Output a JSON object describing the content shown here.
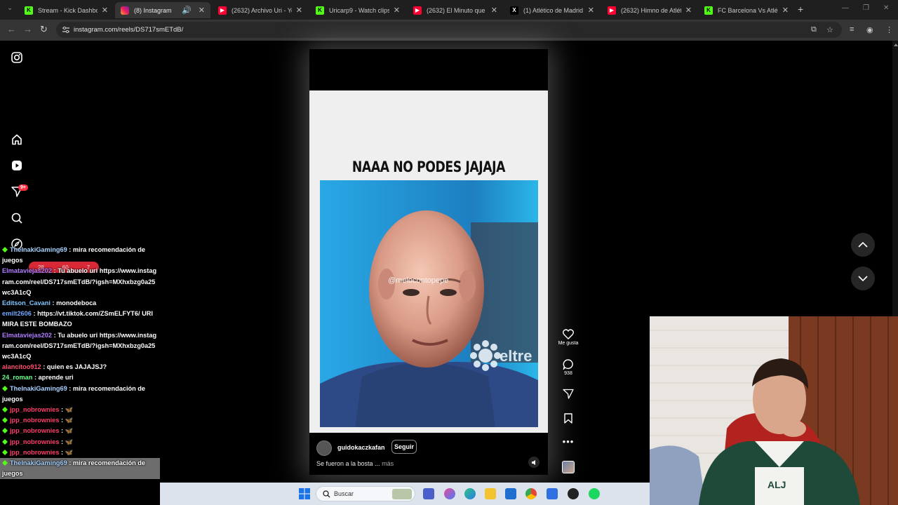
{
  "browser": {
    "tabs": [
      {
        "title": "Stream - Kick Dashboard",
        "favicon": "kick-icon",
        "active": false
      },
      {
        "title": "(8) Instagram",
        "favicon": "instagram-icon",
        "active": true
      },
      {
        "title": "(2632) Archivo Uri - YouTu",
        "favicon": "youtube-icon",
        "active": false
      },
      {
        "title": "Uricarp9 - Watch clips on",
        "favicon": "kick-icon",
        "active": false
      },
      {
        "title": "(2632) El Minuto que DES",
        "favicon": "youtube-icon",
        "active": false
      },
      {
        "title": "(1) Atlético de Madrid on",
        "favicon": "x-icon",
        "active": false
      },
      {
        "title": "(2632) Himno de Atlético",
        "favicon": "youtube-icon",
        "active": false
      },
      {
        "title": "FC Barcelona Vs Atlético",
        "favicon": "kick-icon",
        "active": false
      }
    ],
    "url": "instagram.com/reels/DS717smETdB/"
  },
  "instagram": {
    "nav_badge": "9+",
    "reel": {
      "overlay_text": "NAAA NO PODES JAJAJA",
      "watermark": "@melocontopepe",
      "channel_logo": "eltre",
      "username": "guidokaczkafan",
      "follow_label": "Seguir",
      "caption": "Se fueron a la bosta ...",
      "more_label": "más"
    },
    "actions": {
      "like_label": "Me gusta",
      "comment_count": "938"
    }
  },
  "chat": {
    "reactions": {
      "a": "28",
      "b": "60",
      "c": "7"
    },
    "messages": [
      {
        "user": "TheInakiGaming69",
        "color": "#a9d2ff",
        "text": ": mira recomendación de juegos",
        "badge": true
      },
      {
        "user": "Elmataviejas202",
        "color": "#b07cff",
        "text": ": Tu abuelo uri https://www.instagram.com/reel/DS717smETdB/?igsh=MXhxbzg0a25wc3A1cQ",
        "badge": false
      },
      {
        "user": "Editson_Cavani",
        "color": "#7cc8ff",
        "text": ": monodeboca",
        "badge": false
      },
      {
        "user": "emilt2606",
        "color": "#6fa8ff",
        "text": ": https://vt.tiktok.com/ZSmELFYT6/ URI MIRA ESTE BOMBAZO",
        "badge": false
      },
      {
        "user": "Elmataviejas202",
        "color": "#b07cff",
        "text": ": Tu abuelo uri https://www.instagram.com/reel/DS717smETdB/?igsh=MXhxbzg0a25wc3A1cQ",
        "badge": false
      },
      {
        "user": "alancitoo912",
        "color": "#ff4d6d",
        "text": ": quien es JAJAJSJ?",
        "badge": false
      },
      {
        "user": "24_roman",
        "color": "#6aff8a",
        "text": ": aprende uri",
        "badge": false
      },
      {
        "user": "TheInakiGaming69",
        "color": "#a9d2ff",
        "text": ": mira recomendación de juegos",
        "badge": true
      },
      {
        "user": "jpp_nobrownies",
        "color": "#ff3d6a",
        "text": ": 🦋",
        "badge": true
      },
      {
        "user": "jpp_nobrownies",
        "color": "#ff3d6a",
        "text": ": 🦋",
        "badge": true
      },
      {
        "user": "jpp_nobrownies",
        "color": "#ff3d6a",
        "text": ": 🦋",
        "badge": true
      },
      {
        "user": "jpp_nobrownies",
        "color": "#ff3d6a",
        "text": ": 🦋",
        "badge": true
      },
      {
        "user": "jpp_nobrownies",
        "color": "#ff3d6a",
        "text": ": 🦋",
        "badge": true
      },
      {
        "user": "TheInakiGaming69",
        "color": "#a9d2ff",
        "text": ": mira recomendación de juegos",
        "badge": true
      }
    ]
  },
  "taskbar": {
    "search_placeholder": "Buscar"
  },
  "colors": {
    "kick_green": "#53fc18",
    "ig_badge": "#ff3040",
    "youtube_red": "#ff0033"
  }
}
